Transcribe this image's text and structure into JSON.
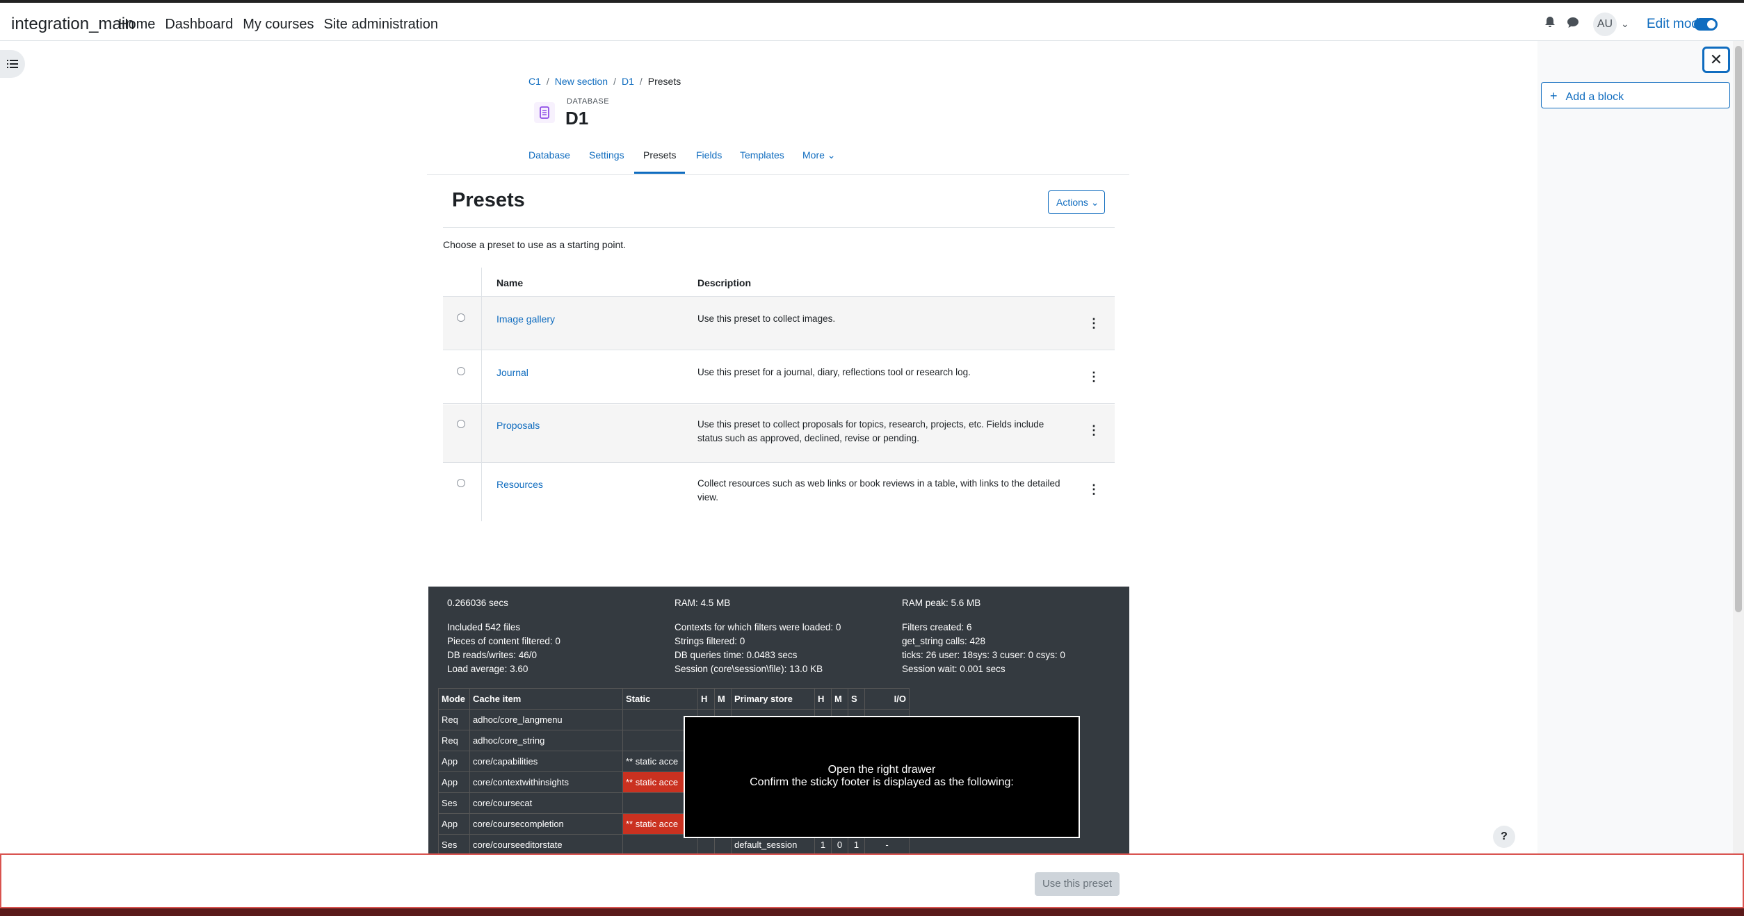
{
  "navbar": {
    "brand": "integration_main",
    "links": [
      "Home",
      "Dashboard",
      "My courses",
      "Site administration"
    ],
    "avatar": "AU",
    "edit_mode_label": "Edit mode",
    "edit_mode_on": true
  },
  "right_drawer": {
    "close_glyph": "✕",
    "add_block_label": "Add a block"
  },
  "breadcrumb": [
    "C1",
    "New section",
    "D1",
    "Presets"
  ],
  "activity": {
    "type": "DATABASE",
    "name": "D1"
  },
  "tabs": [
    {
      "label": "Database"
    },
    {
      "label": "Settings"
    },
    {
      "label": "Presets"
    },
    {
      "label": "Fields"
    },
    {
      "label": "Templates"
    },
    {
      "label": "More ⌄"
    }
  ],
  "page": {
    "title": "Presets",
    "actions_label": "Actions ⌄",
    "intro": "Choose a preset to use as a starting point."
  },
  "presets_table": {
    "headers": [
      "Name",
      "Description"
    ],
    "rows": [
      {
        "name": "Image gallery",
        "description": "Use this preset to collect images."
      },
      {
        "name": "Journal",
        "description": "Use this preset for a journal, diary, reflections tool or research log."
      },
      {
        "name": "Proposals",
        "description": "Use this preset to collect proposals for topics, research, projects, etc. Fields include status such as approved, declined, revise or pending."
      },
      {
        "name": "Resources",
        "description": "Collect resources such as web links or book reviews in a table, with links to the detailed view."
      }
    ]
  },
  "perf": {
    "col1": [
      "0.266036 secs",
      "",
      "Included 542 files",
      "Pieces of content filtered: 0",
      "DB reads/writes: 46/0",
      "Load average: 3.60"
    ],
    "col2": [
      "RAM: 4.5 MB",
      "",
      "Contexts for which filters were loaded: 0",
      "Strings filtered: 0",
      "DB queries time: 0.0483 secs",
      "Session (core\\session\\file): 13.0 KB"
    ],
    "col3": [
      "RAM peak: 5.6 MB",
      "",
      "Filters created: 6",
      "get_string calls: 428",
      "ticks: 26 user: 18sys: 3 cuser: 0 csys: 0",
      "Session wait: 0.001 secs"
    ],
    "cache_headers": [
      "Mode",
      "Cache item",
      "Static",
      "H",
      "M",
      "Primary store",
      "H",
      "M",
      "S",
      "I/O"
    ],
    "cache_rows": [
      [
        "Req",
        "adhoc/core_langmenu",
        "",
        "",
        "",
        "",
        "",
        "",
        "",
        ""
      ],
      [
        "Req",
        "adhoc/core_string",
        "",
        "",
        "",
        "",
        "",
        "",
        "",
        ""
      ],
      [
        "App",
        "core/capabilities",
        "** static acce",
        "",
        "",
        "",
        "",
        "",
        "",
        ""
      ],
      [
        "App",
        "core/contextwithinsights",
        "** static acce",
        "",
        "",
        "",
        "",
        "",
        "",
        ""
      ],
      [
        "Ses",
        "core/coursecat",
        "",
        "",
        "",
        "",
        "",
        "",
        "",
        ""
      ],
      [
        "App",
        "core/coursecompletion",
        "** static acce",
        "",
        "",
        "",
        "",
        "",
        "",
        ""
      ],
      [
        "Ses",
        "core/courseeditorstate",
        "",
        "",
        "",
        "default_session",
        "1",
        "0",
        "1",
        "-"
      ]
    ],
    "red_static_rows": [
      3,
      5
    ]
  },
  "overlay": {
    "line1": "Open the right drawer",
    "line2": "Confirm the sticky footer is displayed as the following:"
  },
  "help_label": "?",
  "footer": {
    "use_preset_label": "Use this preset"
  },
  "colors": {
    "accent": "#0f6cbf",
    "perf_bg": "#343a40",
    "danger": "#ca3120",
    "footer_border": "#d9534f"
  }
}
